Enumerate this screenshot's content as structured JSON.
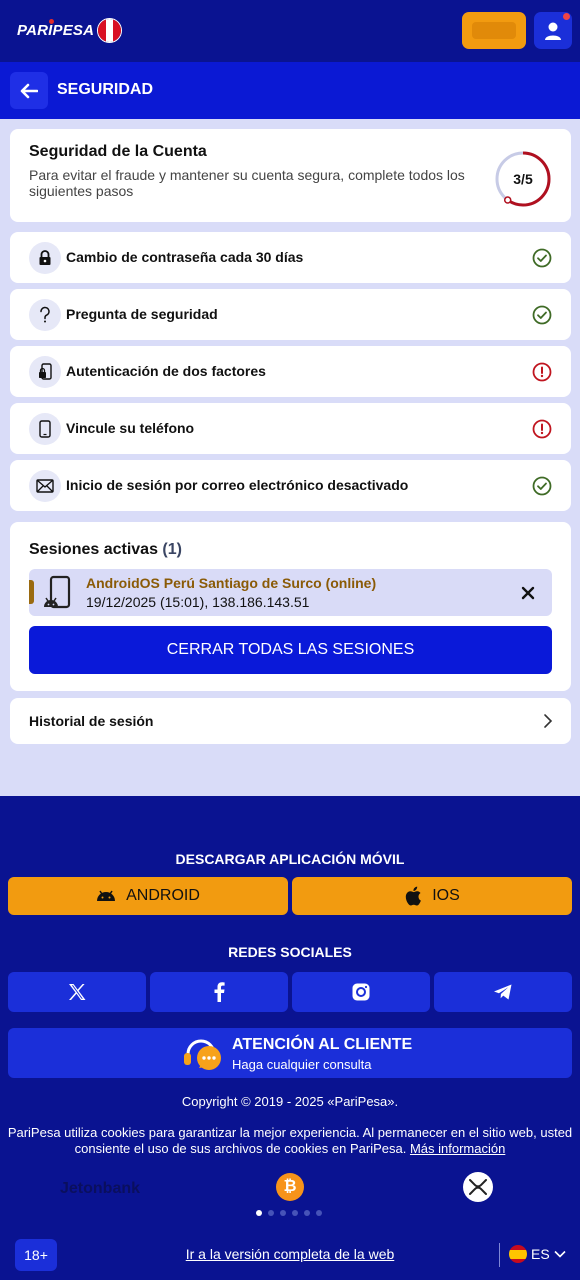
{
  "topbar": {
    "logo": "PARIPESA",
    "flag_colors": [
      "#d91023",
      "#ffffff",
      "#d91023"
    ],
    "accent": "#f29b10"
  },
  "header": {
    "title": "SEGURIDAD"
  },
  "security": {
    "title": "Seguridad de la Cuenta",
    "description": "Para evitar el fraude y mantener su cuenta segura, complete todos los siguientes pasos",
    "progress_label": "3/5",
    "progress_fraction": 0.6
  },
  "items": [
    {
      "label": "Cambio de contraseña cada 30 días",
      "icon": "lock-icon",
      "status": "done"
    },
    {
      "label": "Pregunta de seguridad",
      "icon": "question-icon",
      "status": "done"
    },
    {
      "label": "Autenticación de dos factores",
      "icon": "two-factor-icon",
      "status": "warning"
    },
    {
      "label": "Vincule su teléfono",
      "icon": "phone-icon",
      "status": "warning"
    },
    {
      "label": "Inicio de sesión por correo electrónico desactivado",
      "icon": "email-icon",
      "status": "done"
    }
  ],
  "sessions": {
    "title": "Sesiones activas",
    "count": "(1)",
    "device": "AndroidOS Perú Santiago de Surco (online)",
    "details": "19/12/2025 (15:01), 138.186.143.51",
    "close_all": "CERRAR TODAS LAS SESIONES"
  },
  "history": {
    "label": "Historial de sesión"
  },
  "footer": {
    "download_title": "DESCARGAR APLICACIÓN MÓVIL",
    "android": "ANDROID",
    "ios": "IOS",
    "social_title": "REDES SOCIALES",
    "social": [
      "x-icon",
      "facebook-icon",
      "instagram-icon",
      "telegram-icon"
    ],
    "support_title": "ATENCIÓN AL CLIENTE",
    "support_sub": "Haga cualquier consulta",
    "copyright": "Copyright © 2019 - 2025 «PariPesa».",
    "cookies_text": "PariPesa utiliza cookies para garantizar la mejor experiencia. Al permanecer en el sitio web, usted consiente el uso de sus archivos de cookies en PariPesa.",
    "cookies_link": "Más información",
    "partner": "Jetonbank",
    "age": "18+",
    "full_site": "Ir a la versión completa de la web",
    "lang": "ES"
  },
  "colors": {
    "brand_dark": "#0a1391",
    "brand_blue": "#0b19d4",
    "success": "#3f6b26",
    "warning": "#c0151f",
    "progress": "#b0101f"
  }
}
